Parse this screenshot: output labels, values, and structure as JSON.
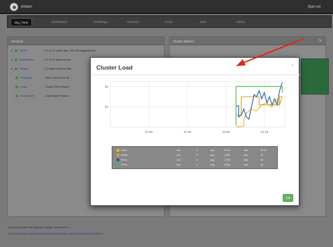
{
  "header": {
    "app_title": "Ambari",
    "signout": "Sign out"
  },
  "nav": {
    "tabs": [
      "Dig_Time",
      "Dashboard",
      "Heatmaps",
      "Services",
      "Hosts",
      "Jobs",
      "Admin"
    ],
    "active": "Dig_Time"
  },
  "services_panel": {
    "title": "Services",
    "rows": [
      {
        "name": "HDFS",
        "desc": "17 of 17 nodes live, 100.0% capacity free",
        "expandable": true
      },
      {
        "name": "MapReduce",
        "desc": "17 of 17 trackers live",
        "expandable": true
      },
      {
        "name": "HBase",
        "desc": "17 region servers live",
        "expandable": true
      },
      {
        "name": "HCatalog",
        "desc": "Hive Client Hive Se...",
        "expandable": false
      },
      {
        "name": "Oozie",
        "desc": "Oozie Client Oozie...",
        "expandable": false
      },
      {
        "name": "ZooKeeper",
        "desc": "ZooKeeper Server...",
        "expandable": false
      }
    ]
  },
  "metrics_panel": {
    "title": "Cluster Metrics"
  },
  "footer": {
    "line1": "Licensed under the Apache License, Version 2.0.",
    "line2": "See third-party tools/resources that Ambari uses and their respective authors"
  },
  "modal": {
    "title": "Cluster Load",
    "close": "×",
    "ok_label": "OK"
  },
  "chart_data": {
    "type": "line",
    "title": "",
    "x_ticks": [
      "11:30",
      "11:45",
      "12:00",
      "12:15"
    ],
    "y_ticks": [
      20,
      40
    ],
    "ylim": [
      0,
      45
    ],
    "xlim_minutes": [
      0,
      68
    ],
    "grid": true,
    "series": [
      {
        "name": "1-min",
        "color": "#f0b323",
        "points": [
          [
            49,
            0.5
          ],
          [
            52,
            1
          ],
          [
            52,
            8
          ],
          [
            53,
            14
          ],
          [
            55,
            18
          ],
          [
            57,
            16
          ],
          [
            59,
            22
          ],
          [
            61,
            24
          ],
          [
            63,
            20
          ],
          [
            65,
            28
          ],
          [
            66,
            22
          ],
          [
            67,
            30
          ]
        ]
      },
      {
        "name": "Nodes",
        "color": "#d9a21e",
        "points": [
          [
            49,
            12
          ],
          [
            51,
            12
          ],
          [
            51,
            30
          ],
          [
            58,
            30
          ],
          [
            58,
            22
          ],
          [
            66,
            22
          ],
          [
            66,
            30
          ],
          [
            67,
            30
          ]
        ]
      },
      {
        "name": "Procs",
        "color": "#1f5fa6",
        "points": [
          [
            49,
            21
          ],
          [
            50,
            21
          ],
          [
            50,
            10
          ],
          [
            51,
            12
          ],
          [
            52,
            18
          ],
          [
            53,
            10
          ],
          [
            54,
            8
          ],
          [
            55,
            20
          ],
          [
            56,
            32
          ],
          [
            57,
            30
          ],
          [
            58,
            36
          ],
          [
            59,
            28
          ],
          [
            60,
            34
          ],
          [
            61,
            24
          ],
          [
            62,
            30
          ],
          [
            63,
            22
          ],
          [
            64,
            28
          ],
          [
            65,
            22
          ],
          [
            66,
            36
          ],
          [
            67,
            44
          ]
        ]
      },
      {
        "name": "CPUs",
        "color": "#3dbf3d",
        "points": [
          [
            49,
            2
          ],
          [
            49,
            40
          ],
          [
            67,
            40
          ],
          [
            67,
            34
          ]
        ]
      }
    ],
    "legend_stats": [
      {
        "name": "1-min",
        "min_label": "min",
        "min": "0",
        "avg_label": "avg",
        "avg": "6.913",
        "max_label": "max",
        "max": "28.48"
      },
      {
        "name": "Nodes",
        "min_label": "min",
        "min": "0",
        "avg_label": "avg",
        "avg": "4.881",
        "max_label": "max",
        "max": "18"
      },
      {
        "name": "Procs",
        "min_label": "min",
        "min": "0",
        "avg_label": "avg",
        "avg": "2.592",
        "max_label": "max",
        "max": "45"
      },
      {
        "name": "CPUs",
        "min_label": "min",
        "min": "0",
        "avg_label": "avg",
        "avg": "6.883",
        "max_label": "max",
        "max": "36"
      }
    ]
  },
  "annotation": {
    "arrow_color": "#e0281c"
  }
}
